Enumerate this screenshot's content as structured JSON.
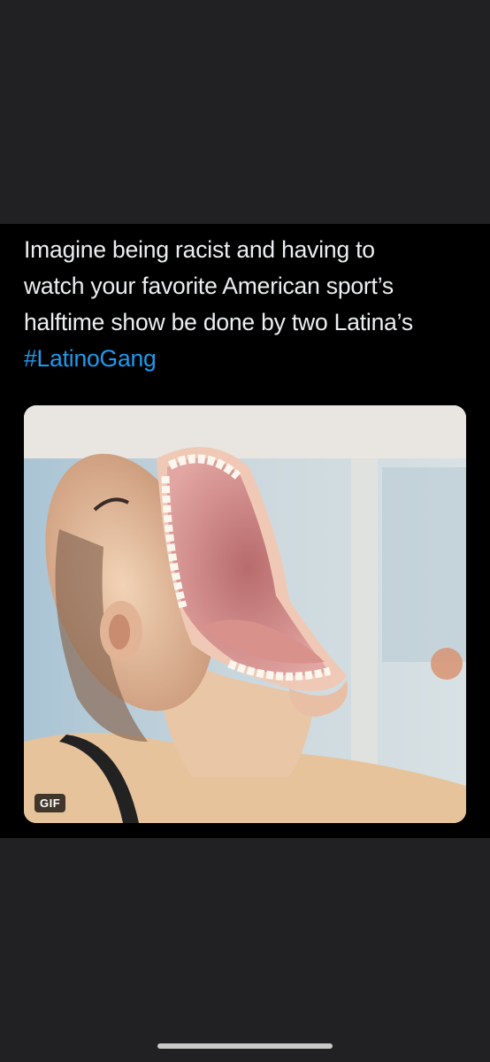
{
  "tweet": {
    "lines": [
      "Imagine being racist and having to",
      "watch your favorite American sport’s",
      "halftime show be done by two Latina’s"
    ],
    "hashtag": "#LatinoGang"
  },
  "media": {
    "badge": "GIF",
    "subject": "person with exaggerated wide open mouth"
  },
  "colors": {
    "background": "#202124",
    "card": "#000000",
    "text": "#eceff1",
    "link": "#1d9bf0"
  }
}
